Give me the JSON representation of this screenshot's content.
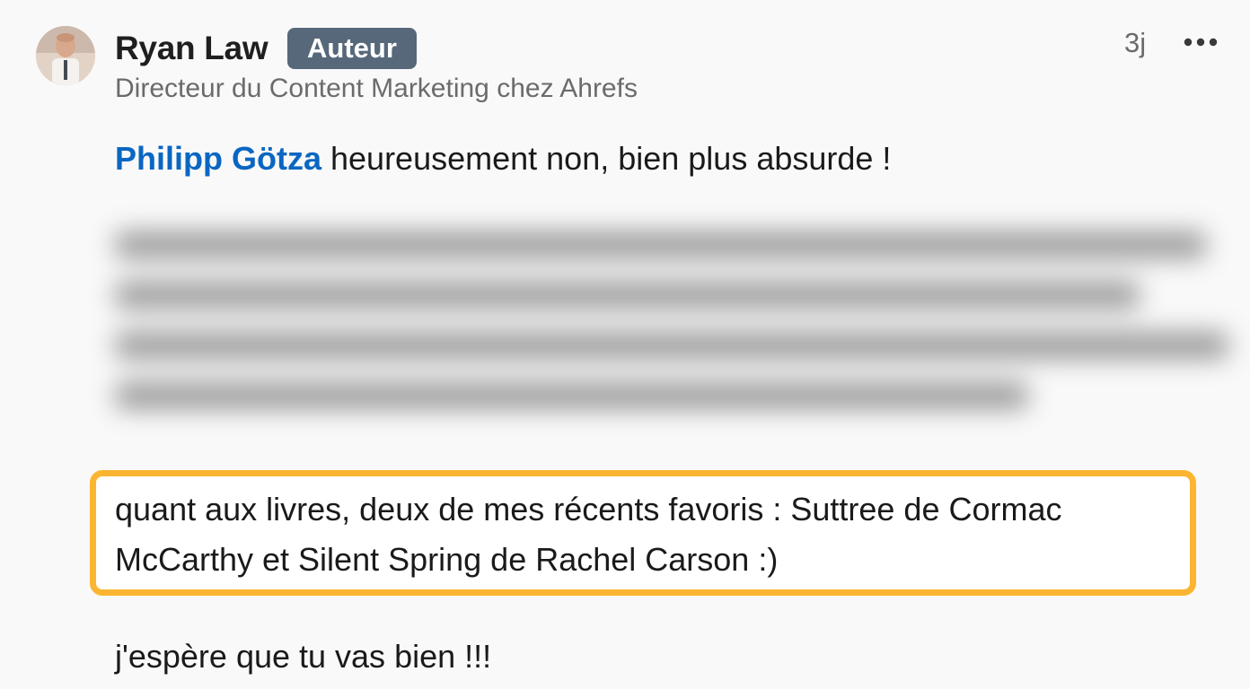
{
  "comment": {
    "author": {
      "name": "Ryan Law",
      "badge": "Auteur",
      "headline": "Directeur du Content Marketing chez Ahrefs",
      "avatar_icon": "person-photo-avatar"
    },
    "timestamp": "3j",
    "more_icon": "more-horizontal-icon",
    "reply": {
      "mention": "Philipp Götza",
      "text": " heureusement non, bien plus absurde !"
    },
    "highlight": {
      "text": "quant aux livres, deux de mes récents favoris : Suttree de Cormac McCarthy et Silent Spring de Rachel Carson :)"
    },
    "closing": "j'espère que tu vas bien !!!"
  },
  "colors": {
    "mention": "#0a66c2",
    "badge_bg": "#56687a",
    "highlight_border": "#fbb531",
    "muted_text": "#6b6b6b"
  }
}
